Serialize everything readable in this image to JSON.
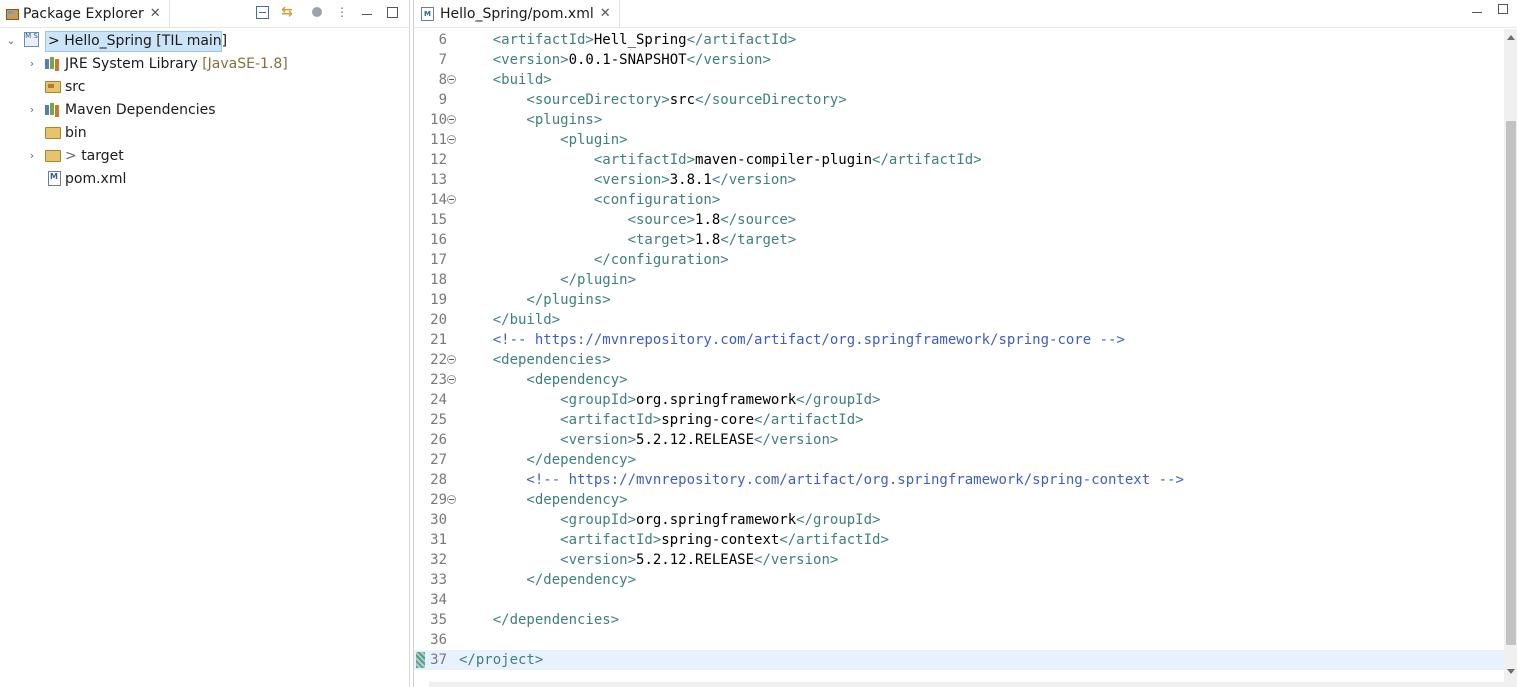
{
  "package_explorer": {
    "tab_label": "Package Explorer",
    "tree": [
      {
        "kind": "project",
        "expanded": true,
        "prefix": "> ",
        "label": "Hello_Spring",
        "decoration": " [TIL main]",
        "selected": true
      },
      {
        "kind": "library",
        "expanded": false,
        "label": "JRE System Library",
        "decoration": " [JavaSE-1.8]"
      },
      {
        "kind": "src-folder",
        "label": "src"
      },
      {
        "kind": "library",
        "expanded": false,
        "label": "Maven Dependencies"
      },
      {
        "kind": "folder",
        "label": "bin"
      },
      {
        "kind": "folder",
        "expanded": false,
        "prefix": "> ",
        "label": "target"
      },
      {
        "kind": "file",
        "label": "pom.xml"
      }
    ],
    "toolbar_icons": [
      "collapse-all-icon",
      "link-with-editor-icon",
      "focus-icon",
      "view-menu-icon",
      "minimize-icon",
      "maximize-icon"
    ]
  },
  "editor": {
    "tab_label": "Hello_Spring/pom.xml",
    "lines": [
      {
        "n": "6",
        "fold": false,
        "parts": [
          [
            "t",
            "    <artifactId>"
          ],
          [
            "x",
            "Hell_Spring"
          ],
          [
            "t",
            "</artifactId>"
          ]
        ]
      },
      {
        "n": "7",
        "fold": false,
        "parts": [
          [
            "t",
            "    <version>"
          ],
          [
            "x",
            "0.0.1-SNAPSHOT"
          ],
          [
            "t",
            "</version>"
          ]
        ]
      },
      {
        "n": "8",
        "fold": true,
        "parts": [
          [
            "t",
            "    <build>"
          ]
        ]
      },
      {
        "n": "9",
        "fold": false,
        "parts": [
          [
            "t",
            "        <sourceDirectory>"
          ],
          [
            "x",
            "src"
          ],
          [
            "t",
            "</sourceDirectory>"
          ]
        ]
      },
      {
        "n": "10",
        "fold": true,
        "parts": [
          [
            "t",
            "        <plugins>"
          ]
        ]
      },
      {
        "n": "11",
        "fold": true,
        "parts": [
          [
            "t",
            "            <plugin>"
          ]
        ]
      },
      {
        "n": "12",
        "fold": false,
        "parts": [
          [
            "t",
            "                <artifactId>"
          ],
          [
            "x",
            "maven-compiler-plugin"
          ],
          [
            "t",
            "</artifactId>"
          ]
        ]
      },
      {
        "n": "13",
        "fold": false,
        "parts": [
          [
            "t",
            "                <version>"
          ],
          [
            "x",
            "3.8.1"
          ],
          [
            "t",
            "</version>"
          ]
        ]
      },
      {
        "n": "14",
        "fold": true,
        "parts": [
          [
            "t",
            "                <configuration>"
          ]
        ]
      },
      {
        "n": "15",
        "fold": false,
        "parts": [
          [
            "t",
            "                    <source>"
          ],
          [
            "x",
            "1.8"
          ],
          [
            "t",
            "</source>"
          ]
        ]
      },
      {
        "n": "16",
        "fold": false,
        "parts": [
          [
            "t",
            "                    <target>"
          ],
          [
            "x",
            "1.8"
          ],
          [
            "t",
            "</target>"
          ]
        ]
      },
      {
        "n": "17",
        "fold": false,
        "parts": [
          [
            "t",
            "                </configuration>"
          ]
        ]
      },
      {
        "n": "18",
        "fold": false,
        "parts": [
          [
            "t",
            "            </plugin>"
          ]
        ]
      },
      {
        "n": "19",
        "fold": false,
        "parts": [
          [
            "t",
            "        </plugins>"
          ]
        ]
      },
      {
        "n": "20",
        "fold": false,
        "parts": [
          [
            "t",
            "    </build>"
          ]
        ]
      },
      {
        "n": "21",
        "fold": false,
        "parts": [
          [
            "c",
            "    <!-- https://mvnrepository.com/artifact/org.springframework/spring-core -->"
          ]
        ]
      },
      {
        "n": "22",
        "fold": true,
        "parts": [
          [
            "t",
            "    <dependencies>"
          ]
        ]
      },
      {
        "n": "23",
        "fold": true,
        "parts": [
          [
            "t",
            "        <dependency>"
          ]
        ]
      },
      {
        "n": "24",
        "fold": false,
        "parts": [
          [
            "t",
            "            <groupId>"
          ],
          [
            "x",
            "org.springframework"
          ],
          [
            "t",
            "</groupId>"
          ]
        ]
      },
      {
        "n": "25",
        "fold": false,
        "parts": [
          [
            "t",
            "            <artifactId>"
          ],
          [
            "x",
            "spring-core"
          ],
          [
            "t",
            "</artifactId>"
          ]
        ]
      },
      {
        "n": "26",
        "fold": false,
        "parts": [
          [
            "t",
            "            <version>"
          ],
          [
            "x",
            "5.2.12.RELEASE"
          ],
          [
            "t",
            "</version>"
          ]
        ]
      },
      {
        "n": "27",
        "fold": false,
        "parts": [
          [
            "t",
            "        </dependency>"
          ]
        ]
      },
      {
        "n": "28",
        "fold": false,
        "parts": [
          [
            "c",
            "        <!-- https://mvnrepository.com/artifact/org.springframework/spring-context -->"
          ]
        ]
      },
      {
        "n": "29",
        "fold": true,
        "parts": [
          [
            "t",
            "        <dependency>"
          ]
        ]
      },
      {
        "n": "30",
        "fold": false,
        "parts": [
          [
            "t",
            "            <groupId>"
          ],
          [
            "x",
            "org.springframework"
          ],
          [
            "t",
            "</groupId>"
          ]
        ]
      },
      {
        "n": "31",
        "fold": false,
        "parts": [
          [
            "t",
            "            <artifactId>"
          ],
          [
            "x",
            "spring-context"
          ],
          [
            "t",
            "</artifactId>"
          ]
        ]
      },
      {
        "n": "32",
        "fold": false,
        "parts": [
          [
            "t",
            "            <version>"
          ],
          [
            "x",
            "5.2.12.RELEASE"
          ],
          [
            "t",
            "</version>"
          ]
        ]
      },
      {
        "n": "33",
        "fold": false,
        "parts": [
          [
            "t",
            "        </dependency>"
          ]
        ]
      },
      {
        "n": "34",
        "fold": false,
        "parts": []
      },
      {
        "n": "35",
        "fold": false,
        "parts": [
          [
            "t",
            "    </dependencies>"
          ]
        ]
      },
      {
        "n": "36",
        "fold": false,
        "parts": []
      },
      {
        "n": "37",
        "fold": false,
        "current": true,
        "marker": true,
        "parts": [
          [
            "t",
            "</project>"
          ]
        ]
      }
    ]
  },
  "colors": {
    "tag": "#3f7f7f",
    "text": "#000000",
    "comment": "#3f5fbf",
    "line_number": "#787878",
    "selection": "#cce4f7",
    "current_line": "#e8f2fe",
    "decoration": "#8a6d3b"
  }
}
